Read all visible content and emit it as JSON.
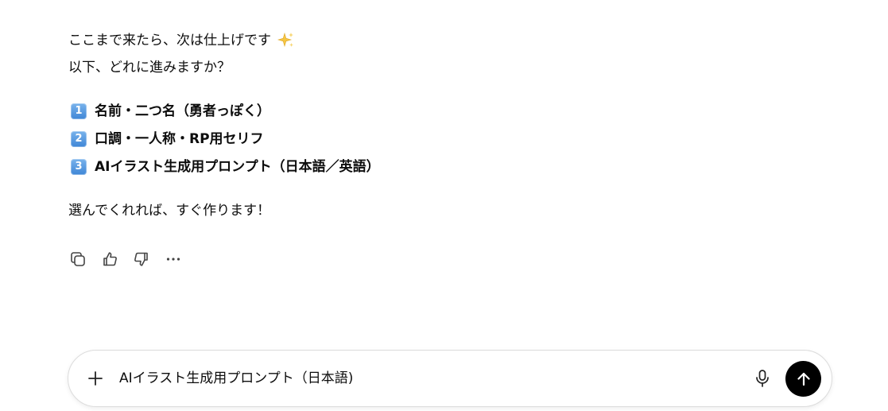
{
  "message": {
    "intro_line1": "ここまで来たら、次は仕上げです",
    "intro_line1_emoji": "sparkles-icon",
    "intro_line2": "以下、どれに進みますか？",
    "options": [
      {
        "number": "1",
        "label": "名前・二つ名（勇者っぽく）"
      },
      {
        "number": "2",
        "label": "口調・一人称・RP用セリフ"
      },
      {
        "number": "3",
        "label": "AIイラスト生成用プロンプト（日本語／英語）"
      }
    ],
    "closing": "選んでくれれば、すぐ作ります！"
  },
  "actions": {
    "copy": "copy-icon",
    "like": "thumbs-up-icon",
    "dislike": "thumbs-down-icon",
    "more": "more-icon"
  },
  "composer": {
    "input_value": "AIイラスト生成用プロンプト（日本語)",
    "add_icon": "plus-icon",
    "mic_icon": "microphone-icon",
    "send_icon": "arrow-up-icon"
  },
  "colors": {
    "text": "#0d0d0d",
    "keycap": "#4a90de",
    "send_button": "#000000",
    "sparkle": "#f5c542"
  }
}
